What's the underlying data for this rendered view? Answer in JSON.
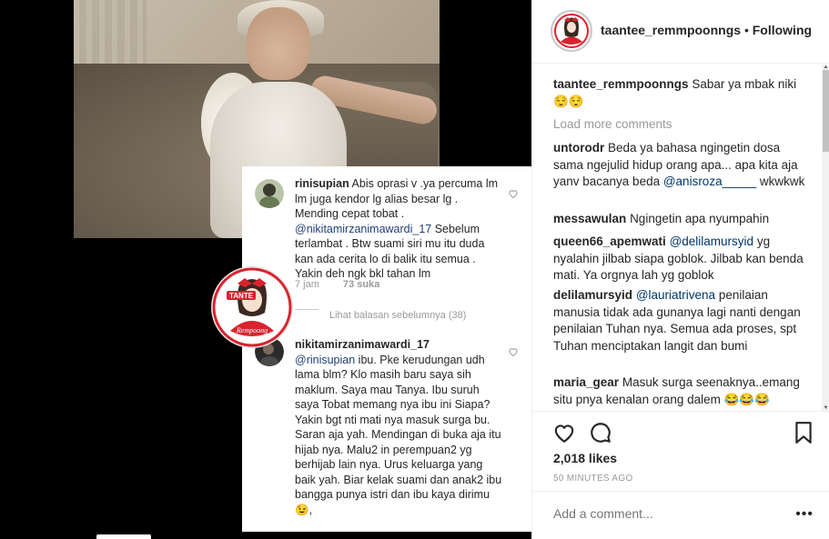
{
  "header": {
    "username": "taantee_remmpoonngs",
    "separator": "•",
    "follow_status": "Following"
  },
  "caption": {
    "username": "taantee_remmpoonngs",
    "text": "Sabar ya mbak niki 😌😌"
  },
  "load_more": "Load more comments",
  "comments": [
    {
      "username": "untorodr",
      "parts": [
        "Beda ya bahasa ngingetin dosa sama ngejulid hidup orang apa... apa kita aja yanv bacanya beda ",
        "@anisroza_____",
        " wkwkwk"
      ]
    },
    {
      "username": "messawulan",
      "parts": [
        "Ngingetin apa nyumpahin",
        "",
        ""
      ]
    },
    {
      "username": "queen66_apemwati",
      "parts": [
        "",
        "@delilamursyid",
        " yg nyalahin jilbab siapa goblok. Jilbab kan benda mati. Ya orgnya lah yg goblok"
      ]
    },
    {
      "username": "delilamursyid",
      "parts": [
        "",
        "@lauriatrivena",
        " penilaian manusia tidak ada gunanya lagi nanti dengan penilaian Tuhan nya. Semua ada proses, spt Tuhan menciptakan langit dan bumi"
      ]
    },
    {
      "username": "maria_gear",
      "parts": [
        "Masuk surga seenaknya..emang situ pnya kenalan orang dalem 😂😂😂",
        "",
        ""
      ]
    }
  ],
  "likes": "2,018 likes",
  "timestamp": "50 MINUTES AGO",
  "add_comment_placeholder": "Add a comment...",
  "more_icon": "•••",
  "embedded_screenshot": {
    "comment1": {
      "username": "rinisupian",
      "lines_before_mention": "Abis oprasi v .ya percuma lm lm juga kendor lg alias besar lg . Mending cepat tobat .",
      "mention": "@nikitamirzanimawardi_17",
      "lines_after_mention": " Sebelum terlambat . Btw suami siri mu itu duda kan ada cerita lo di balik itu semua . Yakin deh ngk bkl tahan lm",
      "time": "7 jam",
      "likes": "73 suka"
    },
    "view_replies": "Lihat balasan sebelumnya (38)",
    "comment2": {
      "username": "nikitamirzanimawardi_17",
      "mention": "@rinisupian",
      "text": " ibu. Pke kerudungan udh lama blm? Klo masih baru saya sih maklum. Saya mau Tanya. Ibu suruh saya Tobat memang nya ibu ini Siapa? Yakin bgt nti mati nya masuk surga bu. Saran aja yah. Mendingan di buka aja itu hijab nya. Malu2 in perempuan2 yg berhijab lain nya. Urus keluarga yang baik yah. Biar kelak suami dan anak2 ibu bangga punya istri dan ibu kaya dirimu 😉,"
    },
    "logo_text_top": "TANTE",
    "logo_text_bottom": "Rempoong"
  },
  "colors": {
    "mention": "#003569",
    "muted": "#999999",
    "logo_red": "#d9232e"
  }
}
